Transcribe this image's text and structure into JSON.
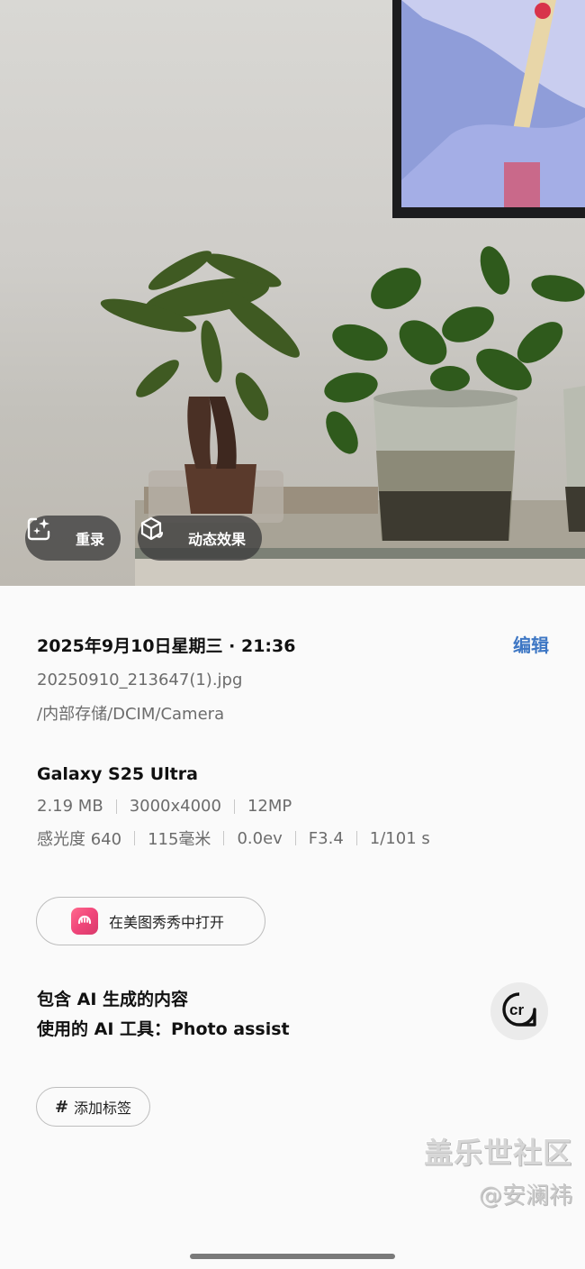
{
  "photo": {
    "remaster_button": {
      "label": "重录",
      "icon": "sparkle-frame-icon"
    },
    "motion_button": {
      "label": "动态效果",
      "icon": "cube-motion-icon"
    }
  },
  "details": {
    "datetime": "2025年9月10日星期三 · 21:36",
    "edit_label": "编辑",
    "filename": "20250910_213647(1).jpg",
    "path": "/内部存储/DCIM/Camera",
    "device": "Galaxy S25 Ultra",
    "specs_row1": [
      "2.19 MB",
      "3000x4000",
      "12MP"
    ],
    "specs_row2": [
      "感光度 640",
      "115毫米",
      "0.0ev",
      "F3.4",
      "1/101 s"
    ],
    "open_in_app": {
      "label": "在美图秀秀中打开",
      "icon": "meitu-app-icon"
    },
    "ai_notice": {
      "line1": "包含 AI 生成的内容",
      "line2": "使用的 AI 工具：Photo assist",
      "badge_icon": "content-credentials-cr-icon"
    },
    "add_tag_label": "添加标签",
    "watermark": {
      "line1": "盖乐世社区",
      "line2": "@安澜祎"
    }
  },
  "colors": {
    "accent": "#3e77c4",
    "background": "#fafafa",
    "muted_text": "#6c6c6c"
  }
}
